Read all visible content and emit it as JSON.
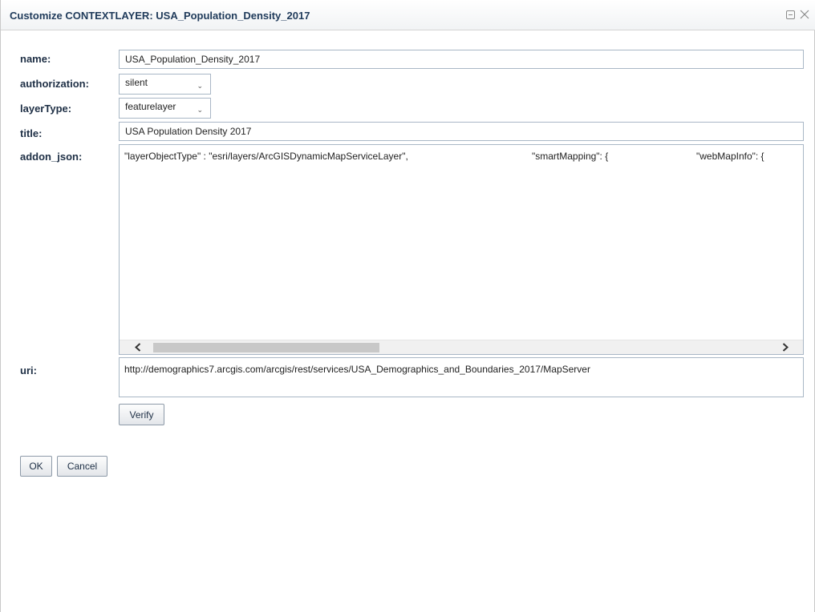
{
  "dialog": {
    "title": "Customize CONTEXTLAYER: USA_Population_Density_2017",
    "icons": {
      "restore": "window-restore-icon",
      "close": "close-icon"
    }
  },
  "fields": {
    "name": {
      "label": "name:",
      "value": "USA_Population_Density_2017"
    },
    "authorization": {
      "label": "authorization:",
      "selected": "silent"
    },
    "layerType": {
      "label": "layerType:",
      "selected": "featurelayer"
    },
    "title": {
      "label": "title:",
      "value": "USA Population Density 2017"
    },
    "addon_json": {
      "label": "addon_json:",
      "chunks": [
        "\"layerObjectType\" : \"esri/layers/ArcGISDynamicMapServiceLayer\",",
        "\"smartMapping\": {",
        "\"webMapInfo\": {"
      ]
    },
    "uri": {
      "label": "uri:",
      "value": "http://demographics7.arcgis.com/arcgis/rest/services/USA_Demographics_and_Boundaries_2017/MapServer"
    }
  },
  "buttons": {
    "verify": "Verify",
    "ok": "OK",
    "cancel": "Cancel"
  },
  "colors": {
    "title_text": "#1f3a5a",
    "label_text": "#1e2f45",
    "field_border": "#a9b7c6"
  }
}
